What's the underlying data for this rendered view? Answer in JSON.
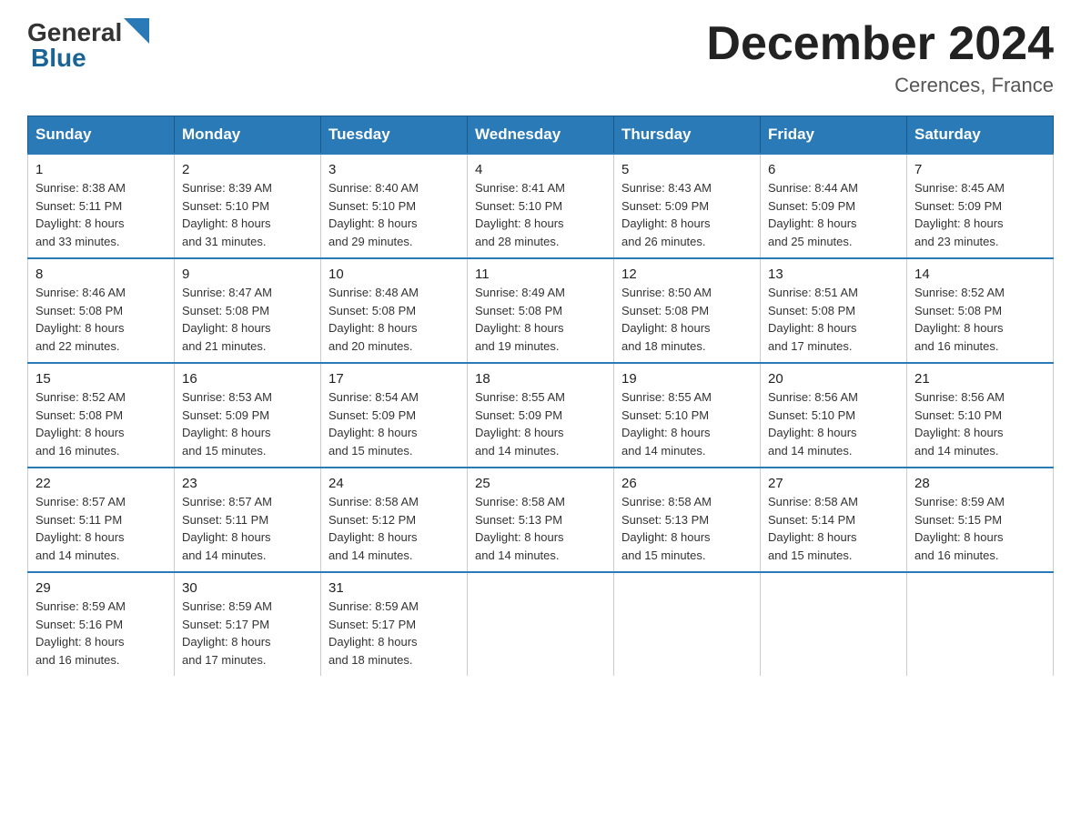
{
  "header": {
    "logo_general": "General",
    "logo_blue": "Blue",
    "title": "December 2024",
    "subtitle": "Cerences, France"
  },
  "days_header": [
    "Sunday",
    "Monday",
    "Tuesday",
    "Wednesday",
    "Thursday",
    "Friday",
    "Saturday"
  ],
  "weeks": [
    [
      {
        "day": "1",
        "sunrise": "8:38 AM",
        "sunset": "5:11 PM",
        "daylight": "8 hours and 33 minutes."
      },
      {
        "day": "2",
        "sunrise": "8:39 AM",
        "sunset": "5:10 PM",
        "daylight": "8 hours and 31 minutes."
      },
      {
        "day": "3",
        "sunrise": "8:40 AM",
        "sunset": "5:10 PM",
        "daylight": "8 hours and 29 minutes."
      },
      {
        "day": "4",
        "sunrise": "8:41 AM",
        "sunset": "5:10 PM",
        "daylight": "8 hours and 28 minutes."
      },
      {
        "day": "5",
        "sunrise": "8:43 AM",
        "sunset": "5:09 PM",
        "daylight": "8 hours and 26 minutes."
      },
      {
        "day": "6",
        "sunrise": "8:44 AM",
        "sunset": "5:09 PM",
        "daylight": "8 hours and 25 minutes."
      },
      {
        "day": "7",
        "sunrise": "8:45 AM",
        "sunset": "5:09 PM",
        "daylight": "8 hours and 23 minutes."
      }
    ],
    [
      {
        "day": "8",
        "sunrise": "8:46 AM",
        "sunset": "5:08 PM",
        "daylight": "8 hours and 22 minutes."
      },
      {
        "day": "9",
        "sunrise": "8:47 AM",
        "sunset": "5:08 PM",
        "daylight": "8 hours and 21 minutes."
      },
      {
        "day": "10",
        "sunrise": "8:48 AM",
        "sunset": "5:08 PM",
        "daylight": "8 hours and 20 minutes."
      },
      {
        "day": "11",
        "sunrise": "8:49 AM",
        "sunset": "5:08 PM",
        "daylight": "8 hours and 19 minutes."
      },
      {
        "day": "12",
        "sunrise": "8:50 AM",
        "sunset": "5:08 PM",
        "daylight": "8 hours and 18 minutes."
      },
      {
        "day": "13",
        "sunrise": "8:51 AM",
        "sunset": "5:08 PM",
        "daylight": "8 hours and 17 minutes."
      },
      {
        "day": "14",
        "sunrise": "8:52 AM",
        "sunset": "5:08 PM",
        "daylight": "8 hours and 16 minutes."
      }
    ],
    [
      {
        "day": "15",
        "sunrise": "8:52 AM",
        "sunset": "5:08 PM",
        "daylight": "8 hours and 16 minutes."
      },
      {
        "day": "16",
        "sunrise": "8:53 AM",
        "sunset": "5:09 PM",
        "daylight": "8 hours and 15 minutes."
      },
      {
        "day": "17",
        "sunrise": "8:54 AM",
        "sunset": "5:09 PM",
        "daylight": "8 hours and 15 minutes."
      },
      {
        "day": "18",
        "sunrise": "8:55 AM",
        "sunset": "5:09 PM",
        "daylight": "8 hours and 14 minutes."
      },
      {
        "day": "19",
        "sunrise": "8:55 AM",
        "sunset": "5:10 PM",
        "daylight": "8 hours and 14 minutes."
      },
      {
        "day": "20",
        "sunrise": "8:56 AM",
        "sunset": "5:10 PM",
        "daylight": "8 hours and 14 minutes."
      },
      {
        "day": "21",
        "sunrise": "8:56 AM",
        "sunset": "5:10 PM",
        "daylight": "8 hours and 14 minutes."
      }
    ],
    [
      {
        "day": "22",
        "sunrise": "8:57 AM",
        "sunset": "5:11 PM",
        "daylight": "8 hours and 14 minutes."
      },
      {
        "day": "23",
        "sunrise": "8:57 AM",
        "sunset": "5:11 PM",
        "daylight": "8 hours and 14 minutes."
      },
      {
        "day": "24",
        "sunrise": "8:58 AM",
        "sunset": "5:12 PM",
        "daylight": "8 hours and 14 minutes."
      },
      {
        "day": "25",
        "sunrise": "8:58 AM",
        "sunset": "5:13 PM",
        "daylight": "8 hours and 14 minutes."
      },
      {
        "day": "26",
        "sunrise": "8:58 AM",
        "sunset": "5:13 PM",
        "daylight": "8 hours and 15 minutes."
      },
      {
        "day": "27",
        "sunrise": "8:58 AM",
        "sunset": "5:14 PM",
        "daylight": "8 hours and 15 minutes."
      },
      {
        "day": "28",
        "sunrise": "8:59 AM",
        "sunset": "5:15 PM",
        "daylight": "8 hours and 16 minutes."
      }
    ],
    [
      {
        "day": "29",
        "sunrise": "8:59 AM",
        "sunset": "5:16 PM",
        "daylight": "8 hours and 16 minutes."
      },
      {
        "day": "30",
        "sunrise": "8:59 AM",
        "sunset": "5:17 PM",
        "daylight": "8 hours and 17 minutes."
      },
      {
        "day": "31",
        "sunrise": "8:59 AM",
        "sunset": "5:17 PM",
        "daylight": "8 hours and 18 minutes."
      },
      null,
      null,
      null,
      null
    ]
  ],
  "labels": {
    "sunrise": "Sunrise:",
    "sunset": "Sunset:",
    "daylight": "Daylight:"
  }
}
